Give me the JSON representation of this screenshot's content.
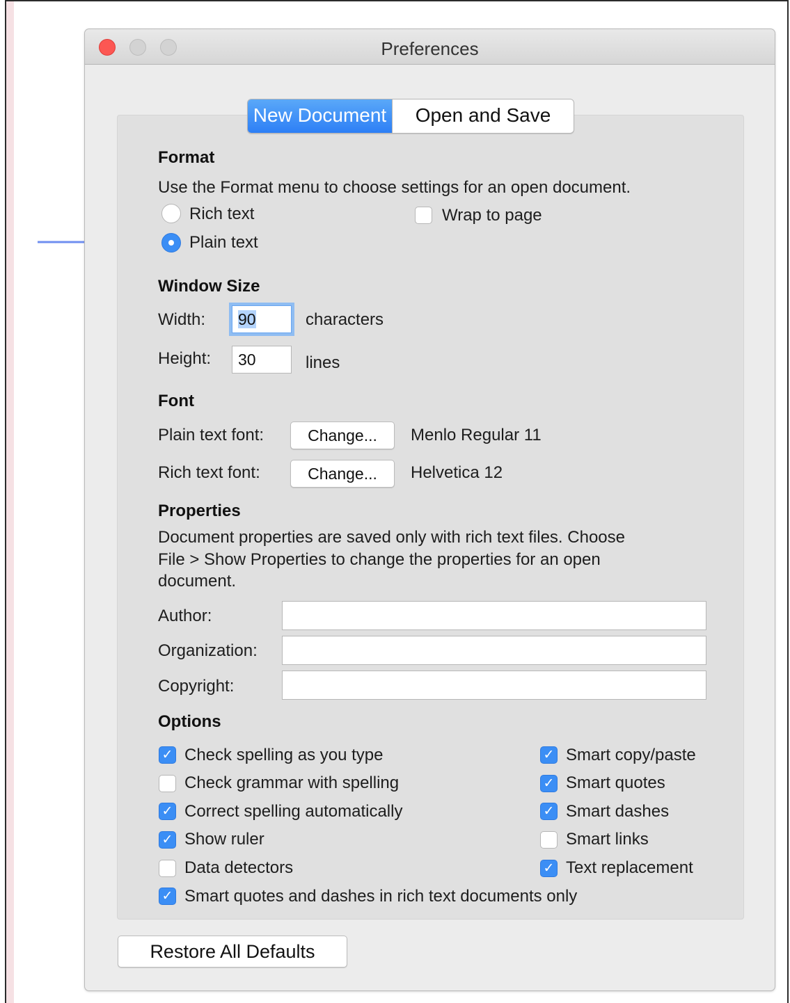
{
  "window": {
    "title": "Preferences"
  },
  "tabs": [
    {
      "label": "New Document",
      "active": true
    },
    {
      "label": "Open and Save",
      "active": false
    }
  ],
  "format": {
    "heading": "Format",
    "description": "Use the Format menu to choose settings for an open document.",
    "rich_text_label": "Rich text",
    "plain_text_label": "Plain text",
    "selected": "Plain text",
    "wrap_to_page_label": "Wrap to page",
    "wrap_to_page_checked": false
  },
  "window_size": {
    "heading": "Window Size",
    "width_label": "Width:",
    "width_value": "90",
    "width_unit": "characters",
    "height_label": "Height:",
    "height_value": "30",
    "height_unit": "lines"
  },
  "font": {
    "heading": "Font",
    "plain_label": "Plain text font:",
    "plain_button": "Change...",
    "plain_value": "Menlo Regular 11",
    "rich_label": "Rich text font:",
    "rich_button": "Change...",
    "rich_value": "Helvetica 12"
  },
  "properties": {
    "heading": "Properties",
    "description_lines": [
      "Document properties are saved only with rich text files. Choose",
      "File > Show Properties to change the properties for an open",
      "document."
    ],
    "author_label": "Author:",
    "author_value": "",
    "organization_label": "Organization:",
    "organization_value": "",
    "copyright_label": "Copyright:",
    "copyright_value": ""
  },
  "options": {
    "heading": "Options",
    "left": [
      {
        "label": "Check spelling as you type",
        "checked": true
      },
      {
        "label": "Check grammar with spelling",
        "checked": false
      },
      {
        "label": "Correct spelling automatically",
        "checked": true
      },
      {
        "label": "Show ruler",
        "checked": true
      },
      {
        "label": "Data detectors",
        "checked": false
      }
    ],
    "right": [
      {
        "label": "Smart copy/paste",
        "checked": true
      },
      {
        "label": "Smart quotes",
        "checked": true
      },
      {
        "label": "Smart dashes",
        "checked": true
      },
      {
        "label": "Smart links",
        "checked": false
      },
      {
        "label": "Text replacement",
        "checked": true
      }
    ],
    "bottom": {
      "label": "Smart quotes and dashes in rich text documents only",
      "checked": true
    }
  },
  "restore_button": "Restore All Defaults",
  "colors": {
    "accent": "#3b8ef5",
    "arrow": "#6f8ff0",
    "close": "#fc5753"
  }
}
